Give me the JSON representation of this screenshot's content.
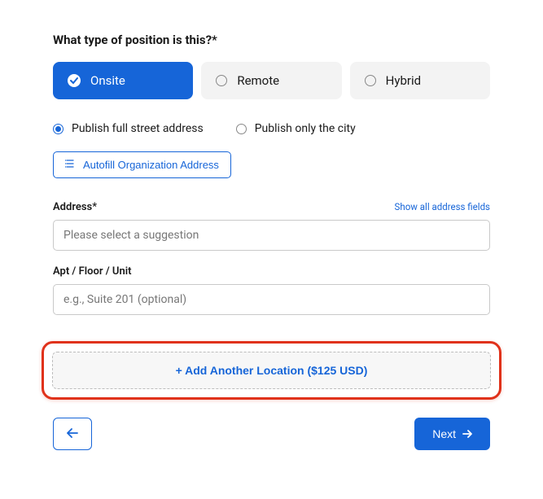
{
  "question": "What type of position is this?*",
  "positionTypes": {
    "onsite": "Onsite",
    "remote": "Remote",
    "hybrid": "Hybrid"
  },
  "publish": {
    "full": "Publish full street address",
    "city": "Publish only the city"
  },
  "autofill": "Autofill Organization Address",
  "fields": {
    "addressLabel": "Address*",
    "addressPlaceholder": "Please select a suggestion",
    "showAll": "Show all address fields",
    "aptLabel": "Apt / Floor / Unit",
    "aptPlaceholder": "e.g., Suite 201 (optional)"
  },
  "addLocation": "+ Add Another Location ($125 USD)",
  "nav": {
    "next": "Next"
  }
}
